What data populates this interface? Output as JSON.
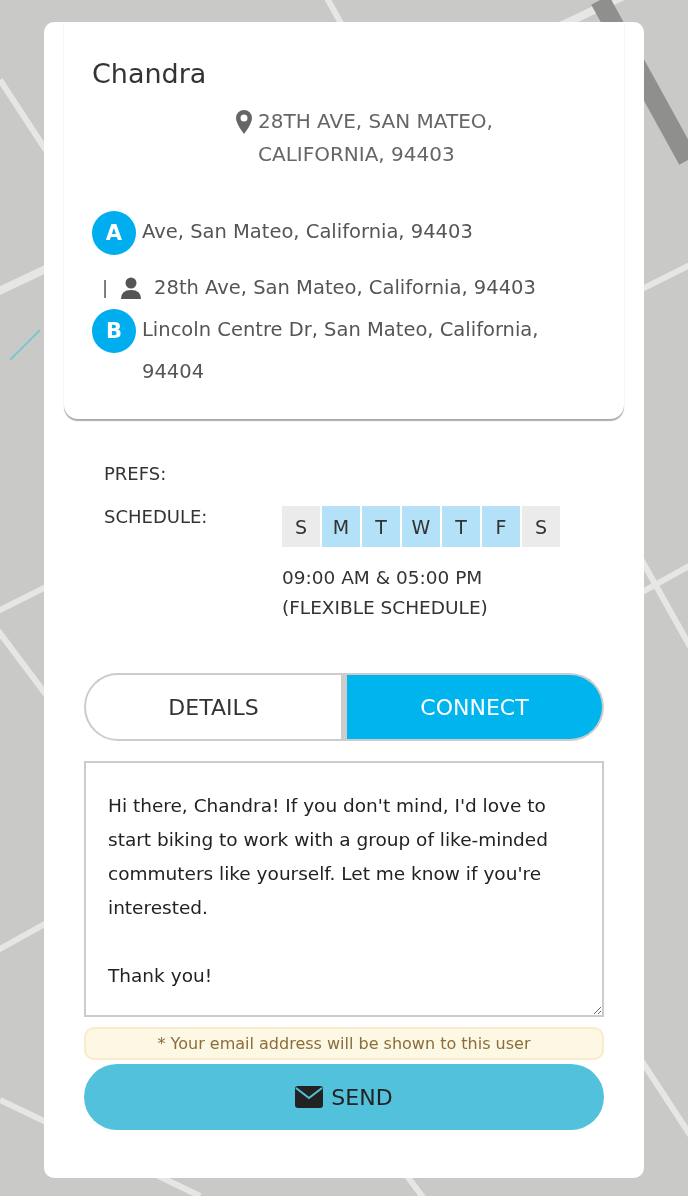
{
  "profile": {
    "name": "Chandra",
    "location": "28TH AVE, SAN MATEO, CALIFORNIA, 94403"
  },
  "route": [
    {
      "kind": "start",
      "marker": "A",
      "address": "Ave, San Mateo, California, 94403"
    },
    {
      "kind": "via",
      "marker": "|",
      "address": "28th Ave, San Mateo, California, 94403"
    },
    {
      "kind": "end",
      "marker": "B",
      "address": "Lincoln Centre Dr, San Mateo, California, 94404"
    }
  ],
  "prefs_label": "PREFS:",
  "schedule": {
    "label": "SCHEDULE:",
    "days": [
      {
        "label": "S",
        "on": false
      },
      {
        "label": "M",
        "on": true
      },
      {
        "label": "T",
        "on": true
      },
      {
        "label": "W",
        "on": true
      },
      {
        "label": "T",
        "on": true
      },
      {
        "label": "F",
        "on": true
      },
      {
        "label": "S",
        "on": false
      }
    ],
    "times": "09:00 AM & 05:00 PM",
    "note": "(FLEXIBLE SCHEDULE)"
  },
  "tabs": [
    {
      "label": "DETAILS",
      "selected": false
    },
    {
      "label": "CONNECT",
      "selected": true
    }
  ],
  "message": {
    "value": "Hi there, Chandra! If you don't mind, I'd love to start biking to work with a group of like-minded commuters like yourself. Let me know if you're interested.\n\nThank you!"
  },
  "notice": "* Your email address will be shown to this user",
  "send_button": "SEND"
}
